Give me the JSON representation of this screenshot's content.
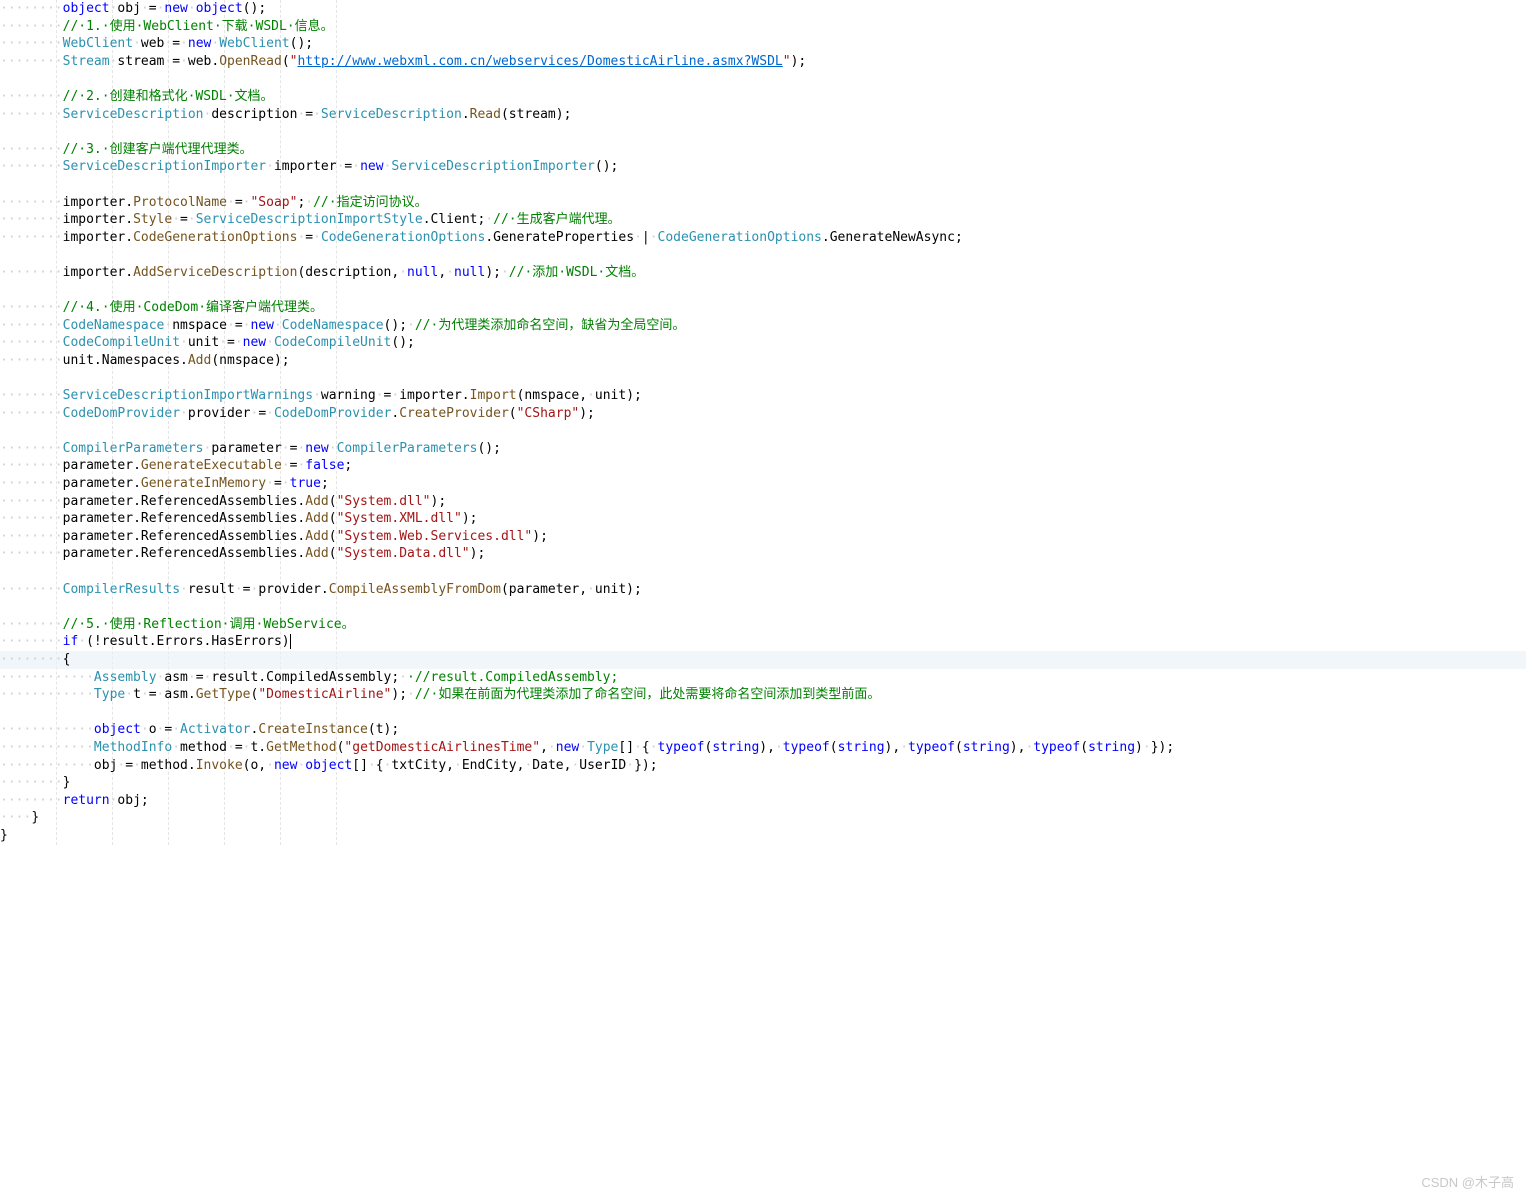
{
  "guide_cols": [
    8,
    16,
    24,
    32,
    40,
    48
  ],
  "highlight_line": 37,
  "watermark": "CSDN @木子高",
  "lines": [
    [
      [
        "ws",
        "········"
      ],
      [
        "kw",
        "object"
      ],
      [
        "ws",
        "·"
      ],
      [
        "",
        "obj"
      ],
      [
        "ws",
        "·"
      ],
      [
        "",
        "="
      ],
      [
        "ws",
        "·"
      ],
      [
        "kw",
        "new"
      ],
      [
        "ws",
        "·"
      ],
      [
        "kw",
        "object"
      ],
      [
        "",
        "();"
      ]
    ],
    [
      [
        "ws",
        "········"
      ],
      [
        "com",
        "//·1.·使用·WebClient·下载·WSDL·信息。"
      ]
    ],
    [
      [
        "ws",
        "········"
      ],
      [
        "type",
        "WebClient"
      ],
      [
        "ws",
        "·"
      ],
      [
        "",
        "web"
      ],
      [
        "ws",
        "·"
      ],
      [
        "",
        "="
      ],
      [
        "ws",
        "·"
      ],
      [
        "kw",
        "new"
      ],
      [
        "ws",
        "·"
      ],
      [
        "type",
        "WebClient"
      ],
      [
        "",
        "();"
      ]
    ],
    [
      [
        "ws",
        "········"
      ],
      [
        "type",
        "Stream"
      ],
      [
        "ws",
        "·"
      ],
      [
        "",
        "stream"
      ],
      [
        "ws",
        "·"
      ],
      [
        "",
        "="
      ],
      [
        "ws",
        "·"
      ],
      [
        "",
        "web."
      ],
      [
        "mth",
        "OpenRead"
      ],
      [
        "",
        "("
      ],
      [
        "str",
        "\""
      ],
      [
        "url",
        "http://www.webxml.com.cn/webservices/DomesticAirline.asmx?WSDL"
      ],
      [
        "str",
        "\""
      ],
      [
        "",
        ");"
      ]
    ],
    [
      [
        "",
        ""
      ]
    ],
    [
      [
        "ws",
        "········"
      ],
      [
        "com",
        "//·2.·创建和格式化·WSDL·文档。"
      ]
    ],
    [
      [
        "ws",
        "········"
      ],
      [
        "type",
        "ServiceDescription"
      ],
      [
        "ws",
        "·"
      ],
      [
        "",
        "description"
      ],
      [
        "ws",
        "·"
      ],
      [
        "",
        "="
      ],
      [
        "ws",
        "·"
      ],
      [
        "type",
        "ServiceDescription"
      ],
      [
        "",
        "."
      ],
      [
        "mth",
        "Read"
      ],
      [
        "",
        "(stream);"
      ]
    ],
    [
      [
        "",
        ""
      ]
    ],
    [
      [
        "ws",
        "········"
      ],
      [
        "com",
        "//·3.·创建客户端代理代理类。"
      ]
    ],
    [
      [
        "ws",
        "········"
      ],
      [
        "type",
        "ServiceDescriptionImporter"
      ],
      [
        "ws",
        "·"
      ],
      [
        "",
        "importer"
      ],
      [
        "ws",
        "·"
      ],
      [
        "",
        "="
      ],
      [
        "ws",
        "·"
      ],
      [
        "kw",
        "new"
      ],
      [
        "ws",
        "·"
      ],
      [
        "type",
        "ServiceDescriptionImporter"
      ],
      [
        "",
        "();"
      ]
    ],
    [
      [
        "",
        ""
      ]
    ],
    [
      [
        "ws",
        "········"
      ],
      [
        "",
        "importer."
      ],
      [
        "mth",
        "ProtocolName"
      ],
      [
        "ws",
        "·"
      ],
      [
        "",
        "="
      ],
      [
        "ws",
        "·"
      ],
      [
        "str",
        "\"Soap\""
      ],
      [
        "",
        ";"
      ],
      [
        "ws",
        "·"
      ],
      [
        "com",
        "//·指定访问协议。"
      ]
    ],
    [
      [
        "ws",
        "········"
      ],
      [
        "",
        "importer."
      ],
      [
        "mth",
        "Style"
      ],
      [
        "ws",
        "·"
      ],
      [
        "",
        "="
      ],
      [
        "ws",
        "·"
      ],
      [
        "type",
        "ServiceDescriptionImportStyle"
      ],
      [
        "",
        ".Client;"
      ],
      [
        "ws",
        "·"
      ],
      [
        "com",
        "//·生成客户端代理。"
      ]
    ],
    [
      [
        "ws",
        "········"
      ],
      [
        "",
        "importer."
      ],
      [
        "mth",
        "CodeGenerationOptions"
      ],
      [
        "ws",
        "·"
      ],
      [
        "",
        "="
      ],
      [
        "ws",
        "·"
      ],
      [
        "type",
        "CodeGenerationOptions"
      ],
      [
        "",
        ".GenerateProperties"
      ],
      [
        "ws",
        "·"
      ],
      [
        "",
        "|"
      ],
      [
        "ws",
        "·"
      ],
      [
        "type",
        "CodeGenerationOptions"
      ],
      [
        "",
        ".GenerateNewAsync;"
      ]
    ],
    [
      [
        "",
        ""
      ]
    ],
    [
      [
        "ws",
        "········"
      ],
      [
        "",
        "importer."
      ],
      [
        "mth",
        "AddServiceDescription"
      ],
      [
        "",
        "(description,"
      ],
      [
        "ws",
        "·"
      ],
      [
        "kw",
        "null"
      ],
      [
        "",
        ","
      ],
      [
        "ws",
        "·"
      ],
      [
        "kw",
        "null"
      ],
      [
        "",
        ");"
      ],
      [
        "ws",
        "·"
      ],
      [
        "com",
        "//·添加·WSDL·文档。"
      ]
    ],
    [
      [
        "",
        ""
      ]
    ],
    [
      [
        "ws",
        "········"
      ],
      [
        "com",
        "//·4.·使用·CodeDom·编译客户端代理类。"
      ]
    ],
    [
      [
        "ws",
        "········"
      ],
      [
        "type",
        "CodeNamespace"
      ],
      [
        "ws",
        "·"
      ],
      [
        "",
        "nmspace"
      ],
      [
        "ws",
        "·"
      ],
      [
        "",
        "="
      ],
      [
        "ws",
        "·"
      ],
      [
        "kw",
        "new"
      ],
      [
        "ws",
        "·"
      ],
      [
        "type",
        "CodeNamespace"
      ],
      [
        "",
        "();"
      ],
      [
        "ws",
        "·"
      ],
      [
        "com",
        "//·为代理类添加命名空间，缺省为全局空间。"
      ]
    ],
    [
      [
        "ws",
        "········"
      ],
      [
        "type",
        "CodeCompileUnit"
      ],
      [
        "ws",
        "·"
      ],
      [
        "",
        "unit"
      ],
      [
        "ws",
        "·"
      ],
      [
        "",
        "="
      ],
      [
        "ws",
        "·"
      ],
      [
        "kw",
        "new"
      ],
      [
        "ws",
        "·"
      ],
      [
        "type",
        "CodeCompileUnit"
      ],
      [
        "",
        "();"
      ]
    ],
    [
      [
        "ws",
        "········"
      ],
      [
        "",
        "unit.Namespaces."
      ],
      [
        "mth",
        "Add"
      ],
      [
        "",
        "(nmspace);"
      ]
    ],
    [
      [
        "",
        ""
      ]
    ],
    [
      [
        "ws",
        "········"
      ],
      [
        "type",
        "ServiceDescriptionImportWarnings"
      ],
      [
        "ws",
        "·"
      ],
      [
        "",
        "warning"
      ],
      [
        "ws",
        "·"
      ],
      [
        "",
        "="
      ],
      [
        "ws",
        "·"
      ],
      [
        "",
        "importer."
      ],
      [
        "mth",
        "Import"
      ],
      [
        "",
        "(nmspace,"
      ],
      [
        "ws",
        "·"
      ],
      [
        "",
        "unit);"
      ]
    ],
    [
      [
        "ws",
        "········"
      ],
      [
        "type",
        "CodeDomProvider"
      ],
      [
        "ws",
        "·"
      ],
      [
        "",
        "provider"
      ],
      [
        "ws",
        "·"
      ],
      [
        "",
        "="
      ],
      [
        "ws",
        "·"
      ],
      [
        "type",
        "CodeDomProvider"
      ],
      [
        "",
        "."
      ],
      [
        "mth",
        "CreateProvider"
      ],
      [
        "",
        "("
      ],
      [
        "str",
        "\"CSharp\""
      ],
      [
        "",
        ");"
      ]
    ],
    [
      [
        "",
        ""
      ]
    ],
    [
      [
        "ws",
        "········"
      ],
      [
        "type",
        "CompilerParameters"
      ],
      [
        "ws",
        "·"
      ],
      [
        "",
        "parameter"
      ],
      [
        "ws",
        "·"
      ],
      [
        "",
        "="
      ],
      [
        "ws",
        "·"
      ],
      [
        "kw",
        "new"
      ],
      [
        "ws",
        "·"
      ],
      [
        "type",
        "CompilerParameters"
      ],
      [
        "",
        "();"
      ]
    ],
    [
      [
        "ws",
        "········"
      ],
      [
        "",
        "parameter."
      ],
      [
        "mth",
        "GenerateExecutable"
      ],
      [
        "ws",
        "·"
      ],
      [
        "",
        "="
      ],
      [
        "ws",
        "·"
      ],
      [
        "kw",
        "false"
      ],
      [
        "",
        ";"
      ]
    ],
    [
      [
        "ws",
        "········"
      ],
      [
        "",
        "parameter."
      ],
      [
        "mth",
        "GenerateInMemory"
      ],
      [
        "ws",
        "·"
      ],
      [
        "",
        "="
      ],
      [
        "ws",
        "·"
      ],
      [
        "kw",
        "true"
      ],
      [
        "",
        ";"
      ]
    ],
    [
      [
        "ws",
        "········"
      ],
      [
        "",
        "parameter.ReferencedAssemblies."
      ],
      [
        "mth",
        "Add"
      ],
      [
        "",
        "("
      ],
      [
        "str",
        "\"System.dll\""
      ],
      [
        "",
        ");"
      ]
    ],
    [
      [
        "ws",
        "········"
      ],
      [
        "",
        "parameter.ReferencedAssemblies."
      ],
      [
        "mth",
        "Add"
      ],
      [
        "",
        "("
      ],
      [
        "str",
        "\"System.XML.dll\""
      ],
      [
        "",
        ");"
      ]
    ],
    [
      [
        "ws",
        "········"
      ],
      [
        "",
        "parameter.ReferencedAssemblies."
      ],
      [
        "mth",
        "Add"
      ],
      [
        "",
        "("
      ],
      [
        "str",
        "\"System.Web.Services.dll\""
      ],
      [
        "",
        ");"
      ]
    ],
    [
      [
        "ws",
        "········"
      ],
      [
        "",
        "parameter.ReferencedAssemblies."
      ],
      [
        "mth",
        "Add"
      ],
      [
        "",
        "("
      ],
      [
        "str",
        "\"System.Data.dll\""
      ],
      [
        "",
        ");"
      ]
    ],
    [
      [
        "",
        ""
      ]
    ],
    [
      [
        "ws",
        "········"
      ],
      [
        "type",
        "CompilerResults"
      ],
      [
        "ws",
        "·"
      ],
      [
        "",
        "result"
      ],
      [
        "ws",
        "·"
      ],
      [
        "",
        "="
      ],
      [
        "ws",
        "·"
      ],
      [
        "",
        "provider."
      ],
      [
        "mth",
        "CompileAssemblyFromDom"
      ],
      [
        "",
        "(parameter,"
      ],
      [
        "ws",
        "·"
      ],
      [
        "",
        "unit);"
      ]
    ],
    [
      [
        "",
        ""
      ]
    ],
    [
      [
        "ws",
        "········"
      ],
      [
        "com",
        "//·5.·使用·Reflection·调用·WebService。"
      ]
    ],
    [
      [
        "ws",
        "········"
      ],
      [
        "kw",
        "if"
      ],
      [
        "ws",
        "·"
      ],
      [
        "",
        "(!result.Errors.HasErrors)"
      ],
      [
        "cursor",
        ""
      ]
    ],
    [
      [
        "ws",
        "········"
      ],
      [
        "",
        "{"
      ]
    ],
    [
      [
        "ws",
        "············"
      ],
      [
        "type",
        "Assembly"
      ],
      [
        "ws",
        "·"
      ],
      [
        "",
        "asm"
      ],
      [
        "ws",
        "·"
      ],
      [
        "",
        "="
      ],
      [
        "ws",
        "·"
      ],
      [
        "",
        "result.CompiledAssembly;"
      ],
      [
        "ws",
        "·"
      ],
      [
        "com",
        "·//result.CompiledAssembly;"
      ]
    ],
    [
      [
        "ws",
        "············"
      ],
      [
        "type",
        "Type"
      ],
      [
        "ws",
        "·"
      ],
      [
        "",
        "t"
      ],
      [
        "ws",
        "·"
      ],
      [
        "",
        "="
      ],
      [
        "ws",
        "·"
      ],
      [
        "",
        "asm."
      ],
      [
        "mth",
        "GetType"
      ],
      [
        "",
        "("
      ],
      [
        "str",
        "\"DomesticAirline\""
      ],
      [
        "",
        ");"
      ],
      [
        "ws",
        "·"
      ],
      [
        "com",
        "//·如果在前面为代理类添加了命名空间，此处需要将命名空间添加到类型前面。"
      ]
    ],
    [
      [
        "",
        ""
      ]
    ],
    [
      [
        "ws",
        "············"
      ],
      [
        "kw",
        "object"
      ],
      [
        "ws",
        "·"
      ],
      [
        "",
        "o"
      ],
      [
        "ws",
        "·"
      ],
      [
        "",
        "="
      ],
      [
        "ws",
        "·"
      ],
      [
        "type",
        "Activator"
      ],
      [
        "",
        "."
      ],
      [
        "mth",
        "CreateInstance"
      ],
      [
        "",
        "(t);"
      ]
    ],
    [
      [
        "ws",
        "············"
      ],
      [
        "type",
        "MethodInfo"
      ],
      [
        "ws",
        "·"
      ],
      [
        "",
        "method"
      ],
      [
        "ws",
        "·"
      ],
      [
        "",
        "="
      ],
      [
        "ws",
        "·"
      ],
      [
        "",
        "t."
      ],
      [
        "mth",
        "GetMethod"
      ],
      [
        "",
        "("
      ],
      [
        "str",
        "\"getDomesticAirlinesTime\""
      ],
      [
        "",
        ","
      ],
      [
        "ws",
        "·"
      ],
      [
        "kw",
        "new"
      ],
      [
        "ws",
        "·"
      ],
      [
        "type",
        "Type"
      ],
      [
        "",
        "[]"
      ],
      [
        "ws",
        "·"
      ],
      [
        "",
        "{"
      ],
      [
        "ws",
        "·"
      ],
      [
        "kw",
        "typeof"
      ],
      [
        "",
        "("
      ],
      [
        "kw",
        "string"
      ],
      [
        "",
        "),"
      ],
      [
        "ws",
        "·"
      ],
      [
        "kw",
        "typeof"
      ],
      [
        "",
        "("
      ],
      [
        "kw",
        "string"
      ],
      [
        "",
        "),"
      ],
      [
        "ws",
        "·"
      ],
      [
        "kw",
        "typeof"
      ],
      [
        "",
        "("
      ],
      [
        "kw",
        "string"
      ],
      [
        "",
        "),"
      ],
      [
        "ws",
        "·"
      ],
      [
        "kw",
        "typeof"
      ],
      [
        "",
        "("
      ],
      [
        "kw",
        "string"
      ],
      [
        "",
        ")"
      ],
      [
        "ws",
        "·"
      ],
      [
        "",
        "});"
      ]
    ],
    [
      [
        "ws",
        "············"
      ],
      [
        "",
        "obj"
      ],
      [
        "ws",
        "·"
      ],
      [
        "",
        "="
      ],
      [
        "ws",
        "·"
      ],
      [
        "",
        "method."
      ],
      [
        "mth",
        "Invoke"
      ],
      [
        "",
        "(o,"
      ],
      [
        "ws",
        "·"
      ],
      [
        "kw",
        "new"
      ],
      [
        "ws",
        "·"
      ],
      [
        "kw",
        "object"
      ],
      [
        "",
        "[]"
      ],
      [
        "ws",
        "·"
      ],
      [
        "",
        "{"
      ],
      [
        "ws",
        "·"
      ],
      [
        "",
        "txtCity,"
      ],
      [
        "ws",
        "·"
      ],
      [
        "",
        "EndCity,"
      ],
      [
        "ws",
        "·"
      ],
      [
        "",
        "Date,"
      ],
      [
        "ws",
        "·"
      ],
      [
        "",
        "UserID"
      ],
      [
        "ws",
        "·"
      ],
      [
        "",
        "});"
      ]
    ],
    [
      [
        "ws",
        "········"
      ],
      [
        "",
        "}"
      ]
    ],
    [
      [
        "ws",
        "········"
      ],
      [
        "kw",
        "return"
      ],
      [
        "ws",
        "·"
      ],
      [
        "",
        "obj;"
      ]
    ],
    [
      [
        "ws",
        "····"
      ],
      [
        "",
        "}"
      ]
    ],
    [
      [
        "",
        "}"
      ]
    ]
  ]
}
